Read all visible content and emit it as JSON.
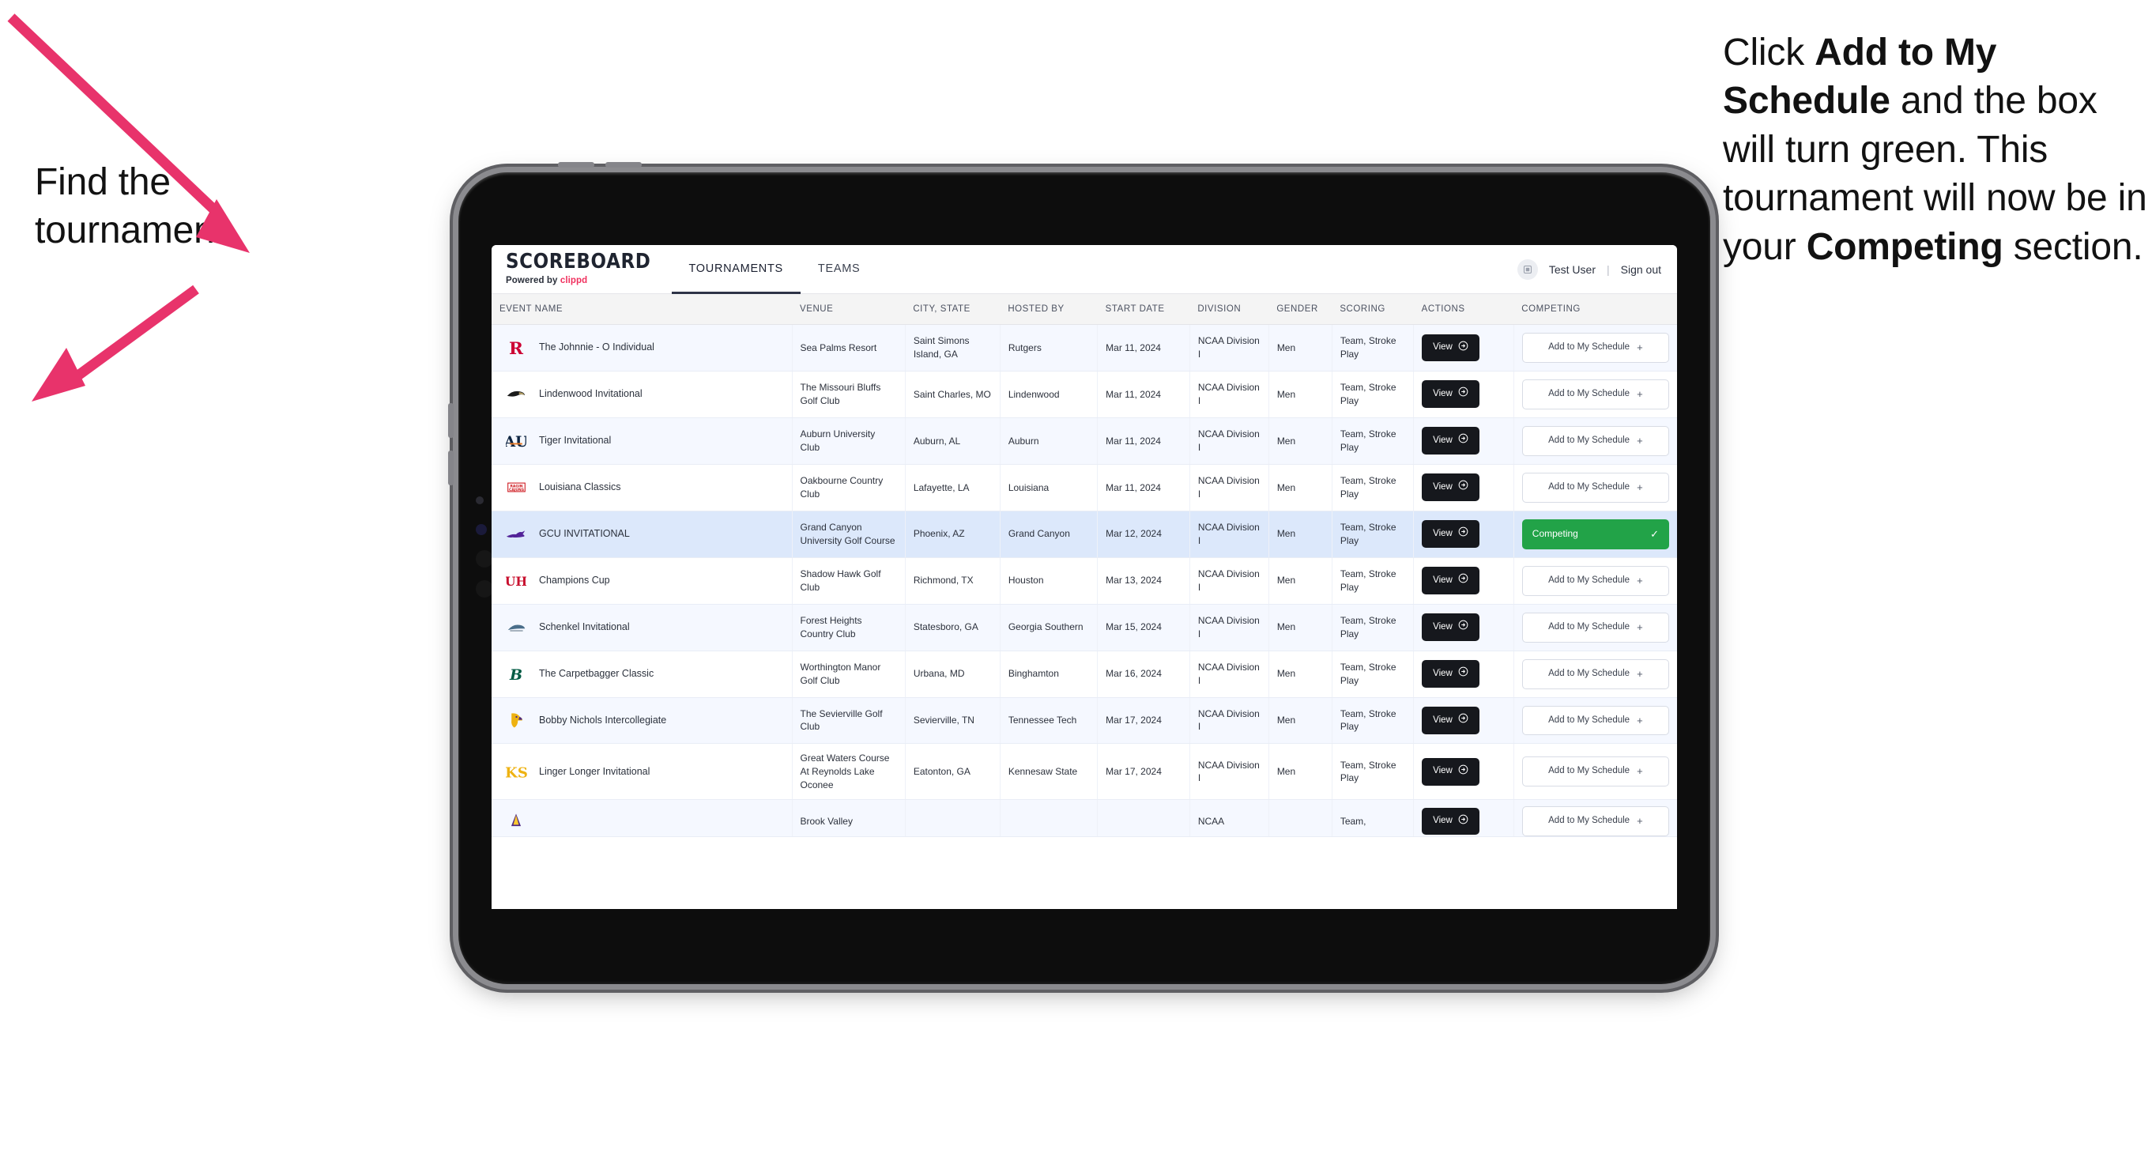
{
  "annotations": {
    "left": {
      "line1": "Find the",
      "line2": "tournament."
    },
    "right": {
      "seg1": "Click ",
      "bold1": "Add to My Schedule",
      "seg2": " and the box will turn green. This tournament will now be in your ",
      "bold2": "Competing",
      "seg3": " section."
    },
    "arrow_color": "#e8336b"
  },
  "app": {
    "brand": {
      "name": "SCOREBOARD",
      "powered_prefix": "Powered by ",
      "powered_brand": "clippd"
    },
    "tabs": [
      {
        "label": "TOURNAMENTS",
        "active": true
      },
      {
        "label": "TEAMS",
        "active": false
      }
    ],
    "account": {
      "avatar_icon": "user-avatar-icon",
      "user": "Test User",
      "separator": "|",
      "signout": "Sign out"
    }
  },
  "table": {
    "columns": [
      "EVENT NAME",
      "VENUE",
      "CITY, STATE",
      "HOSTED BY",
      "START DATE",
      "DIVISION",
      "GENDER",
      "SCORING",
      "ACTIONS",
      "COMPETING"
    ],
    "action_label": "View",
    "add_label": "Add to My Schedule",
    "add_icon": "plus-icon",
    "competing_label": "Competing",
    "competing_icon": "check-icon",
    "competing_color": "#22a348",
    "rows": [
      {
        "logo": "rutgers-logo",
        "event": "The Johnnie - O Individual",
        "venue": "Sea Palms Resort",
        "city": "Saint Simons Island, GA",
        "hosted": "Rutgers",
        "date": "Mar 11, 2024",
        "division": "NCAA Division I",
        "gender": "Men",
        "scoring": "Team, Stroke Play",
        "competing": false,
        "selected": false
      },
      {
        "logo": "lindenwood-logo",
        "event": "Lindenwood Invitational",
        "venue": "The Missouri Bluffs Golf Club",
        "city": "Saint Charles, MO",
        "hosted": "Lindenwood",
        "date": "Mar 11, 2024",
        "division": "NCAA Division I",
        "gender": "Men",
        "scoring": "Team, Stroke Play",
        "competing": false,
        "selected": false
      },
      {
        "logo": "auburn-logo",
        "event": "Tiger Invitational",
        "venue": "Auburn University Club",
        "city": "Auburn, AL",
        "hosted": "Auburn",
        "date": "Mar 11, 2024",
        "division": "NCAA Division I",
        "gender": "Men",
        "scoring": "Team, Stroke Play",
        "competing": false,
        "selected": false
      },
      {
        "logo": "louisiana-logo",
        "event": "Louisiana Classics",
        "venue": "Oakbourne Country Club",
        "city": "Lafayette, LA",
        "hosted": "Louisiana",
        "date": "Mar 11, 2024",
        "division": "NCAA Division I",
        "gender": "Men",
        "scoring": "Team, Stroke Play",
        "competing": false,
        "selected": false
      },
      {
        "logo": "gcu-logo",
        "event": "GCU INVITATIONAL",
        "venue": "Grand Canyon University Golf Course",
        "city": "Phoenix, AZ",
        "hosted": "Grand Canyon",
        "date": "Mar 12, 2024",
        "division": "NCAA Division I",
        "gender": "Men",
        "scoring": "Team, Stroke Play",
        "competing": true,
        "selected": true
      },
      {
        "logo": "houston-logo",
        "event": "Champions Cup",
        "venue": "Shadow Hawk Golf Club",
        "city": "Richmond, TX",
        "hosted": "Houston",
        "date": "Mar 13, 2024",
        "division": "NCAA Division I",
        "gender": "Men",
        "scoring": "Team, Stroke Play",
        "competing": false,
        "selected": false
      },
      {
        "logo": "georgia-southern-logo",
        "event": "Schenkel Invitational",
        "venue": "Forest Heights Country Club",
        "city": "Statesboro, GA",
        "hosted": "Georgia Southern",
        "date": "Mar 15, 2024",
        "division": "NCAA Division I",
        "gender": "Men",
        "scoring": "Team, Stroke Play",
        "competing": false,
        "selected": false
      },
      {
        "logo": "binghamton-logo",
        "event": "The Carpetbagger Classic",
        "venue": "Worthington Manor Golf Club",
        "city": "Urbana, MD",
        "hosted": "Binghamton",
        "date": "Mar 16, 2024",
        "division": "NCAA Division I",
        "gender": "Men",
        "scoring": "Team, Stroke Play",
        "competing": false,
        "selected": false
      },
      {
        "logo": "tennessee-tech-logo",
        "event": "Bobby Nichols Intercollegiate",
        "venue": "The Sevierville Golf Club",
        "city": "Sevierville, TN",
        "hosted": "Tennessee Tech",
        "date": "Mar 17, 2024",
        "division": "NCAA Division I",
        "gender": "Men",
        "scoring": "Team, Stroke Play",
        "competing": false,
        "selected": false
      },
      {
        "logo": "kennesaw-state-logo",
        "event": "Linger Longer Invitational",
        "venue": "Great Waters Course At Reynolds Lake Oconee",
        "city": "Eatonton, GA",
        "hosted": "Kennesaw State",
        "date": "Mar 17, 2024",
        "division": "NCAA Division I",
        "gender": "Men",
        "scoring": "Team, Stroke Play",
        "competing": false,
        "selected": false
      },
      {
        "logo": "ecu-logo",
        "event": "",
        "venue": "Brook Valley",
        "city": "",
        "hosted": "",
        "date": "",
        "division": "NCAA",
        "gender": "",
        "scoring": "Team,",
        "competing": false,
        "selected": false,
        "clipped": true
      }
    ]
  }
}
